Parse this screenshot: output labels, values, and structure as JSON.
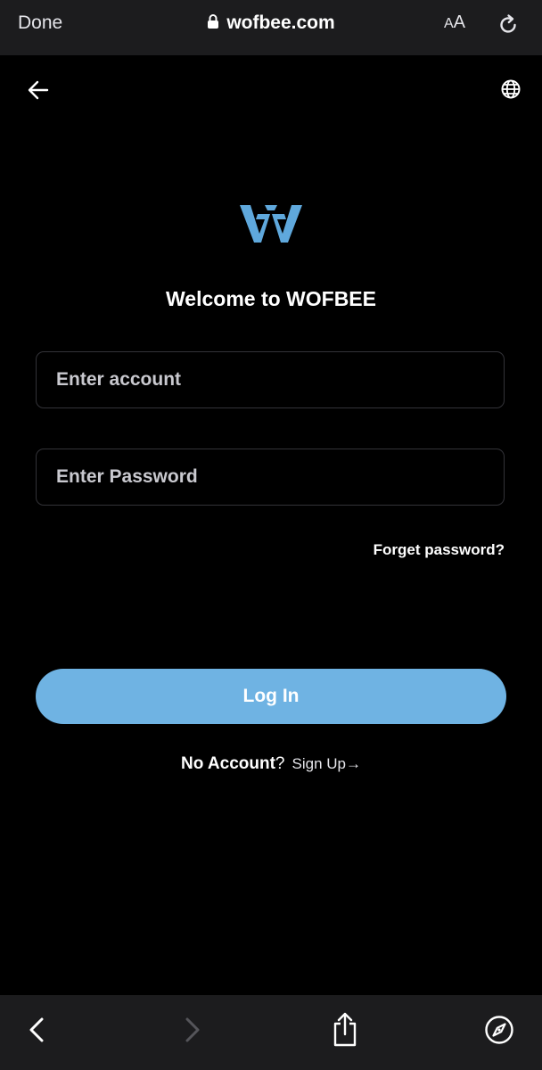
{
  "browser": {
    "done_label": "Done",
    "url": "wofbee.com",
    "text_size_label_small": "A",
    "text_size_label_large": "A"
  },
  "page": {
    "title": "Welcome to WOFBEE",
    "account_placeholder": "Enter account",
    "password_placeholder": "Enter Password",
    "forgot_label": "Forget password?",
    "login_label": "Log In",
    "no_account_label": "No Account",
    "question_mark": "?",
    "signup_label": "Sign Up→"
  },
  "icons": {
    "back": "back-arrow-icon",
    "language": "globe-icon",
    "logo": "wofbee-logo-icon",
    "lock": "lock-icon",
    "reload": "reload-icon",
    "nav_back": "chevron-left-icon",
    "nav_forward": "chevron-right-icon",
    "share": "share-icon",
    "compass": "compass-icon"
  },
  "colors": {
    "background": "#000000",
    "toolbar": "#1c1c1e",
    "accent": "#6fb3e3",
    "logo": "#5fa8dc"
  }
}
